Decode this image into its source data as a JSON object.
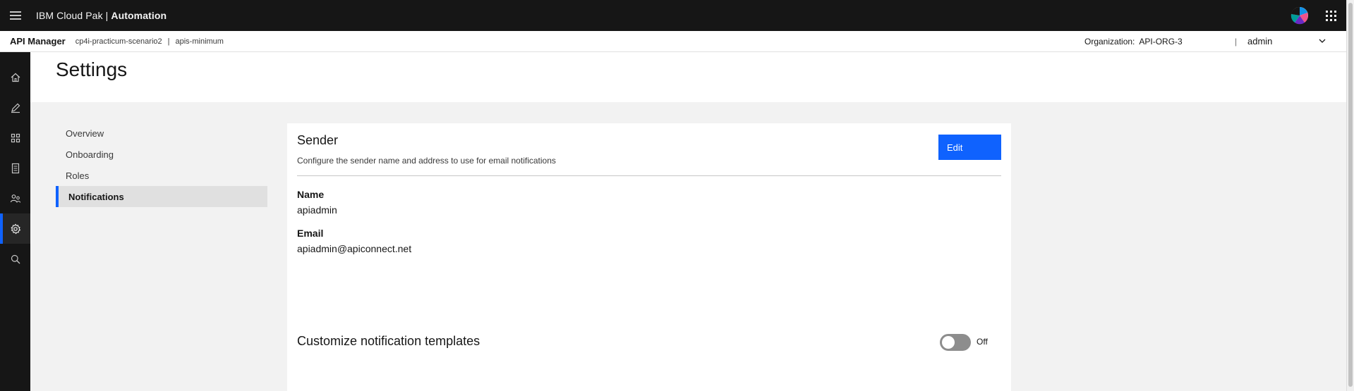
{
  "topbar": {
    "brand_prefix": "IBM Cloud Pak | ",
    "brand_name": "Automation"
  },
  "subheader": {
    "app_name": "API Manager",
    "catalog": "cp4i-practicum-scenario2",
    "separator": "|",
    "space": "apis-minimum",
    "org_label": "Organization:",
    "org_value": "API-ORG-3",
    "user_separator": "|",
    "user": "admin"
  },
  "sidenav": {
    "items": [
      {
        "icon": "home-icon"
      },
      {
        "icon": "edit-icon"
      },
      {
        "icon": "apps-icon"
      },
      {
        "icon": "document-icon"
      },
      {
        "icon": "members-icon"
      },
      {
        "icon": "settings-icon",
        "active": true
      },
      {
        "icon": "search-icon"
      }
    ]
  },
  "page": {
    "title": "Settings"
  },
  "settings_nav": {
    "items": [
      {
        "label": "Overview"
      },
      {
        "label": "Onboarding"
      },
      {
        "label": "Roles"
      },
      {
        "label": "Notifications",
        "active": true
      }
    ]
  },
  "sender": {
    "title": "Sender",
    "description": "Configure the sender name and address to use for email notifications",
    "edit_label": "Edit",
    "name_label": "Name",
    "name_value": "apiadmin",
    "email_label": "Email",
    "email_value": "apiadmin@apiconnect.net"
  },
  "templates": {
    "title": "Customize notification templates",
    "toggle_state": "Off"
  },
  "colors": {
    "accent": "#0f62fe",
    "topbar": "#161616",
    "background": "#f2f2f2"
  }
}
